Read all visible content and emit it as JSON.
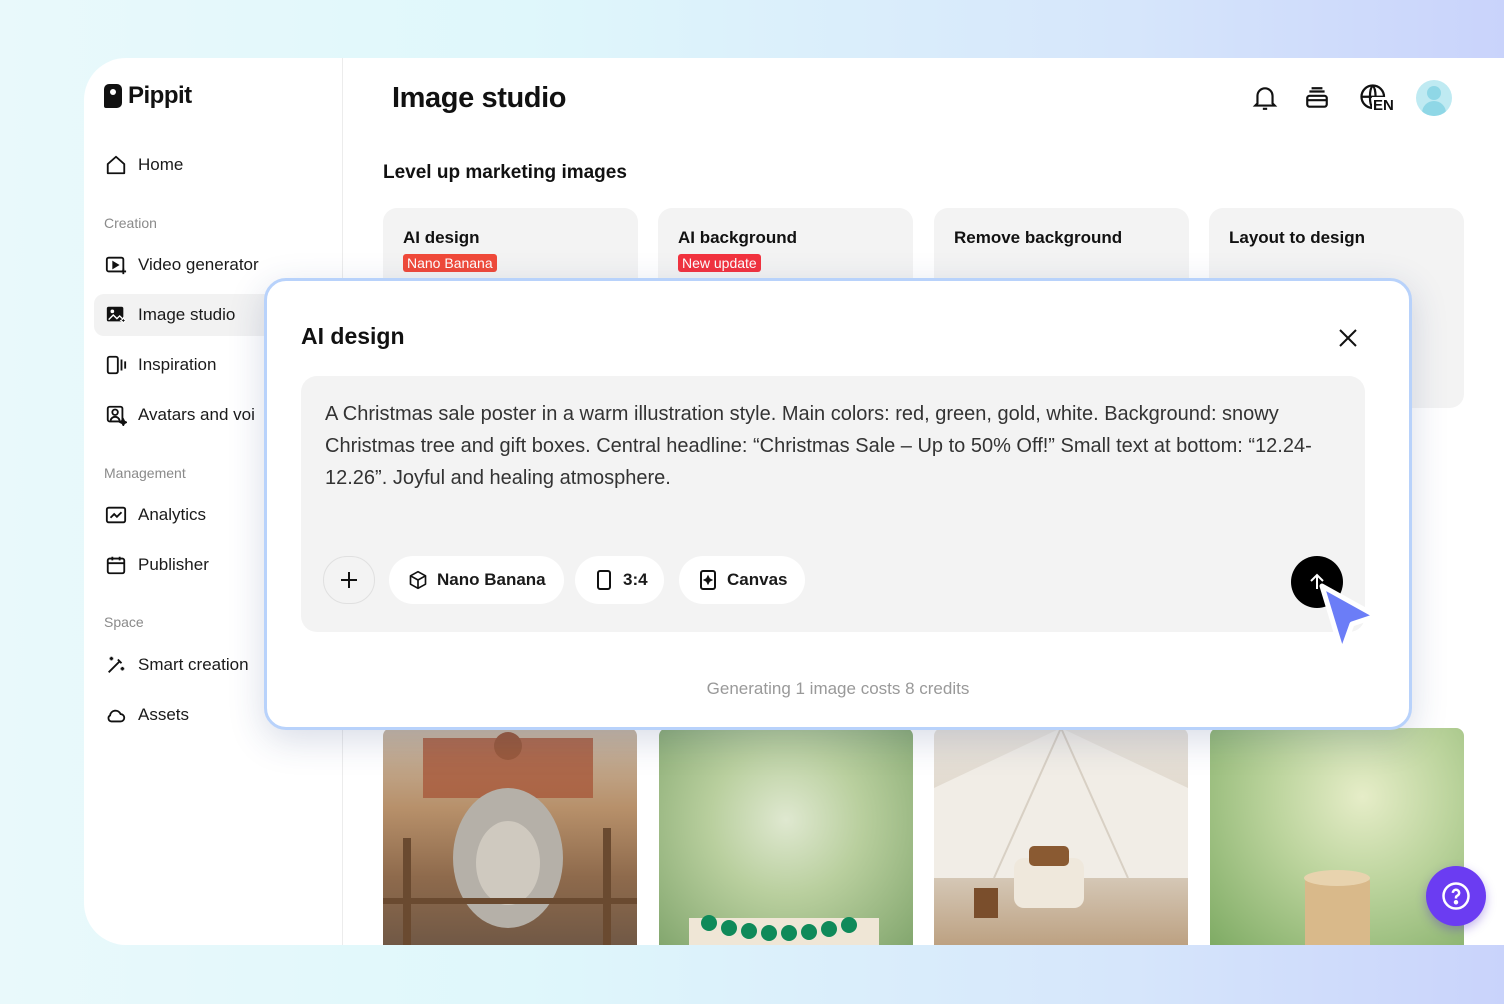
{
  "app": {
    "brand": "Pippit",
    "page_title": "Image studio"
  },
  "sidebar": {
    "home": "Home",
    "sections": {
      "creation": "Creation",
      "management": "Management",
      "space": "Space"
    },
    "items": [
      {
        "label": "Video generator",
        "icon": "video-plus-icon"
      },
      {
        "label": "Image studio",
        "icon": "image-sparkle-icon",
        "active": true
      },
      {
        "label": "Inspiration",
        "icon": "inspiration-icon"
      },
      {
        "label": "Avatars and voi",
        "icon": "avatar-icon"
      },
      {
        "label": "Analytics",
        "icon": "analytics-icon"
      },
      {
        "label": "Publisher",
        "icon": "calendar-icon"
      },
      {
        "label": "Smart creation",
        "icon": "magic-wand-icon"
      },
      {
        "label": "Assets",
        "icon": "cloud-icon"
      }
    ]
  },
  "header": {
    "language": "EN"
  },
  "main": {
    "subheading": "Level up marketing images",
    "cards": [
      {
        "title": "AI design",
        "badge": "Nano Banana",
        "badge_color": "#f04a3a"
      },
      {
        "title": "AI background",
        "badge": "New update",
        "badge_color": "#f2333f"
      },
      {
        "title": "Remove background"
      },
      {
        "title": "Layout to design"
      }
    ]
  },
  "modal": {
    "title": "AI design",
    "prompt": "A Christmas sale poster in a warm illustration style. Main colors: red, green, gold, white. Background: snowy Christmas tree and gift boxes. Central headline: “Christmas Sale – Up to 50% Off!” Small text at bottom: “12.24-12.26”. Joyful and healing atmosphere.",
    "chips": {
      "model": "Nano Banana",
      "ratio": "3:4",
      "canvas": "Canvas"
    },
    "cost_text": "Generating 1 image costs 8 credits"
  },
  "colors": {
    "accent": "#6b3cf2",
    "badge_red": "#f2333f",
    "modal_border": "#b8d2fb"
  }
}
